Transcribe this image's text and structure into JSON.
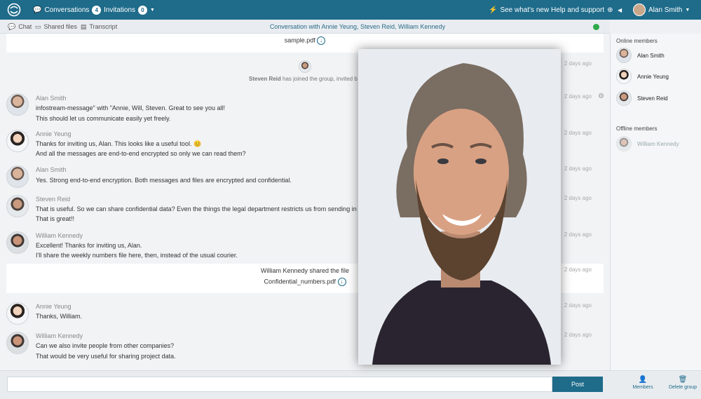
{
  "topbar": {
    "conversations_label": "Conversations",
    "conversations_count": "4",
    "invitations_label": "Invitations",
    "invitations_count": "0",
    "whats_new": "See what's new",
    "help": "Help and support",
    "user": "Alan Smith"
  },
  "subbar": {
    "chat": "Chat",
    "files": "Shared files",
    "transcript": "Transcript",
    "title": "Conversation with Annie Yeung, Steven Reid, William Kennedy"
  },
  "file1": {
    "name": "sample.pdf"
  },
  "join": {
    "name": "Steven Reid",
    "text": " has joined the group, invited b",
    "time": "2 days ago"
  },
  "messages": [
    {
      "name": "Alan Smith",
      "lines": [
        "infostream-message\" with \"Annie, Will, Steven. Great to see you all!",
        "This should let us communicate easily yet freely."
      ],
      "time": "2 days ago"
    },
    {
      "name": "Annie Yeung",
      "lines": [
        "Thanks for inviting us, Alan. This looks like a useful tool. 😊",
        "And all the messages are end-to-end encrypted so only we can read them?"
      ],
      "time": "2 days ago"
    },
    {
      "name": "Alan Smith",
      "lines": [
        "Yes. Strong end-to-end encryption. Both messages and files are encrypted and confidential."
      ],
      "time": "2 days ago"
    },
    {
      "name": "Steven Reid",
      "lines": [
        "That is useful. So we can share confidential data? Even the things the legal department restricts us from sending in em",
        "That is great!!"
      ],
      "time": "2 days ago"
    },
    {
      "name": "William Kennedy",
      "lines": [
        "Excellent! Thanks for inviting us, Alan.",
        "I'll share the weekly numbers file here, then, instead of the usual courier."
      ],
      "time": "2 days ago"
    },
    {
      "name": "Annie Yeung",
      "lines": [
        "Thanks, William."
      ],
      "time": "2 days ago"
    },
    {
      "name": "William Kennedy",
      "lines": [
        "Can we also invite people from other companies?",
        "That would be very useful for sharing project data."
      ],
      "time": "2 days ago"
    }
  ],
  "file2": {
    "text": "William Kennedy shared the file",
    "name": "Confidential_numbers.pdf",
    "time": "2 days ago"
  },
  "sidebar": {
    "online_header": "Online members",
    "online": [
      "Alan Smith",
      "Annie Yeung",
      "Steven Reid"
    ],
    "offline_header": "Offline members",
    "offline": [
      "William Kennedy"
    ]
  },
  "footer": {
    "post": "Post",
    "members": "Members",
    "delete_group": "Delete group"
  },
  "colors": {
    "brand": "#1e6b8a",
    "online": "#2eaa4a"
  },
  "icons": [
    "logo-icon",
    "chat-bubble-icon",
    "chevron-down-icon",
    "lightbulb-icon",
    "globe-icon",
    "triangle-left-icon",
    "folder-icon",
    "document-icon",
    "download-icon",
    "gear-icon",
    "person-icon",
    "trash-icon"
  ]
}
